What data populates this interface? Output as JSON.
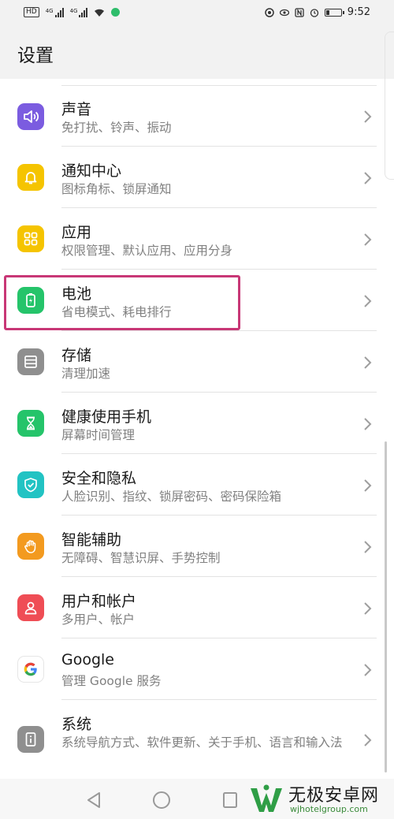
{
  "status_bar": {
    "left_badge": "HD",
    "signal_tag_1": "4G",
    "signal_tag_2": "4G",
    "time": "9:52",
    "battery_level": 0.25
  },
  "header": {
    "title": "设置"
  },
  "items": [
    {
      "title": "声音",
      "subtitle": "免打扰、铃声、振动",
      "icon": "speaker-icon",
      "color": "#7b5ce0"
    },
    {
      "title": "通知中心",
      "subtitle": "图标角标、锁屏通知",
      "icon": "bell-icon",
      "color": "#f5c400"
    },
    {
      "title": "应用",
      "subtitle": "权限管理、默认应用、应用分身",
      "icon": "apps-grid-icon",
      "color": "#f5c400"
    },
    {
      "title": "电池",
      "subtitle": "省电模式、耗电排行",
      "icon": "battery-icon",
      "color": "#25c46a"
    },
    {
      "title": "存储",
      "subtitle": "清理加速",
      "icon": "storage-icon",
      "color": "#8f8f8f"
    },
    {
      "title": "健康使用手机",
      "subtitle": "屏幕时间管理",
      "icon": "hourglass-icon",
      "color": "#25c46a"
    },
    {
      "title": "安全和隐私",
      "subtitle": "人脸识别、指纹、锁屏密码、密码保险箱",
      "icon": "shield-icon",
      "color": "#22c3c3"
    },
    {
      "title": "智能辅助",
      "subtitle": "无障碍、智慧识屏、手势控制",
      "icon": "hand-icon",
      "color": "#f39a1f"
    },
    {
      "title": "用户和帐户",
      "subtitle": "多用户、帐户",
      "icon": "user-icon",
      "color": "#ef4d55"
    },
    {
      "title": "Google",
      "subtitle": "管理 Google 服务",
      "icon": "google-icon",
      "color": "#ffffff"
    },
    {
      "title": "系统",
      "subtitle": "系统导航方式、软件更新、关于手机、语言和输入法",
      "icon": "system-info-icon",
      "color": "#8f8f8f"
    }
  ],
  "highlighted_item": "电池",
  "highlight_color": "#c83776",
  "watermark": {
    "name": "无极安卓网",
    "url": "wjhotelgroup.com"
  }
}
